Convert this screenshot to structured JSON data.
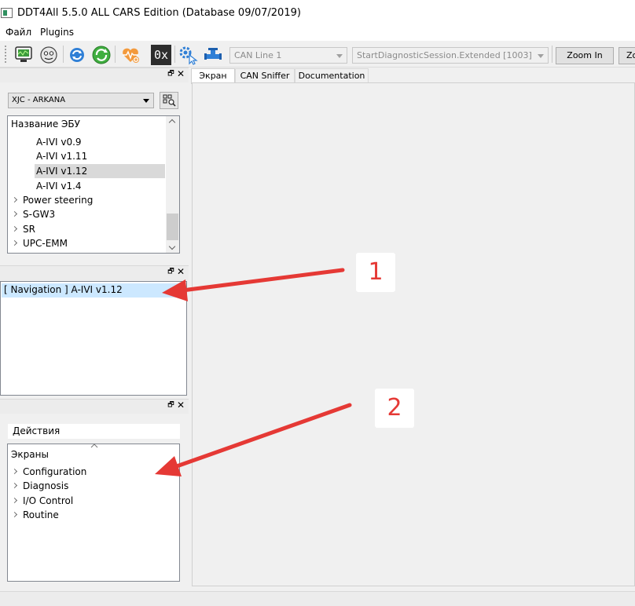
{
  "window": {
    "title": "DDT4All 5.5.0 ALL CARS Edition (Database 09/07/2019)"
  },
  "menu": {
    "items": [
      "Файл",
      "Plugins"
    ]
  },
  "toolbar": {
    "can_line": "CAN Line 1",
    "session": "StartDiagnosticSession.Extended [1003]",
    "zoom_in": "Zoom In",
    "zoom_out": "Zo",
    "hex_icon_label": "0x"
  },
  "ecu_panel": {
    "selected_vehicle": "XJC - ARKANA",
    "header": "Название ЭБУ",
    "children": [
      "A-IVI v0.9",
      "A-IVI v1.11",
      "A-IVI v1.12",
      "A-IVI v1.4"
    ],
    "groups": [
      "Power steering",
      "S-GW3",
      "SR",
      "UPC-EMM"
    ]
  },
  "screens_panel": {
    "selected": "[ Navigation ] A-IVI v1.12"
  },
  "actions_panel": {
    "label": "Действия",
    "tree_header": "Экраны",
    "categories": [
      "Configuration",
      "Diagnosis",
      "I/O Control",
      "Routine"
    ]
  },
  "tabs": [
    "Экран",
    "CAN Sniffer",
    "Documentation"
  ],
  "callouts": [
    "1",
    "2"
  ],
  "colors": {
    "accent_selected": "#cce8ff",
    "callout_red": "#e53935"
  }
}
